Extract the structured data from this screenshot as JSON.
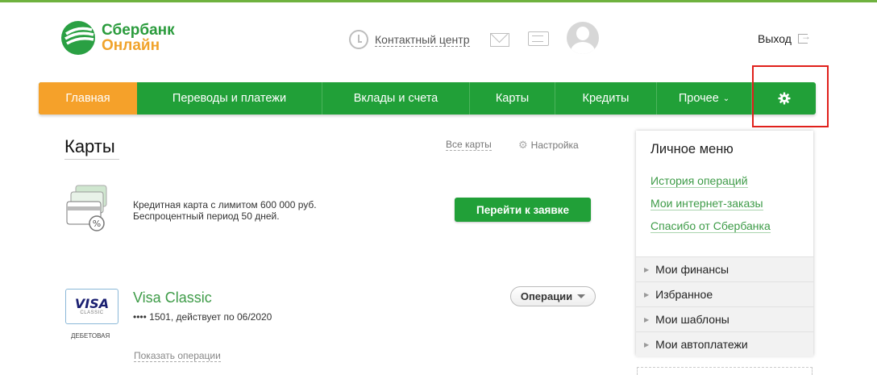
{
  "header": {
    "logo_line1": "Сбербанк",
    "logo_line2": "Онлайн",
    "contact_center": "Контактный центр",
    "logout": "Выход"
  },
  "nav": {
    "items": [
      {
        "label": "Главная",
        "active": true
      },
      {
        "label": "Переводы и платежи"
      },
      {
        "label": "Вклады и счета"
      },
      {
        "label": "Карты"
      },
      {
        "label": "Кредиты"
      },
      {
        "label": "Прочее"
      }
    ],
    "more_chevron": "⌄",
    "settings_icon": "gear-icon"
  },
  "main": {
    "title": "Карты",
    "all_cards": "Все карты",
    "settings": "Настройка",
    "promo_line1": "Кредитная карта с лимитом 600 000 руб.",
    "promo_line2": "Беспроцентный период 50 дней.",
    "apply_button": "Перейти к заявке",
    "card": {
      "brand": "VISA",
      "tier": "CLASSIC",
      "type": "ДЕБЕТОВАЯ",
      "name": "Visa Classic",
      "number_info": "•••• 1501, действует по 06/2020",
      "operations_button": "Операции",
      "show_operations": "Показать операции"
    }
  },
  "side": {
    "title": "Личное меню",
    "links": [
      "История операций",
      "Мои интернет-заказы",
      "Спасибо от Сбербанка"
    ],
    "menu": [
      "Мои финансы",
      "Избранное",
      "Мои шаблоны",
      "Мои автоплатежи"
    ]
  },
  "colors": {
    "brand_green": "#21a038",
    "active_orange": "#f5a12a",
    "highlight_red": "#e0201b"
  }
}
